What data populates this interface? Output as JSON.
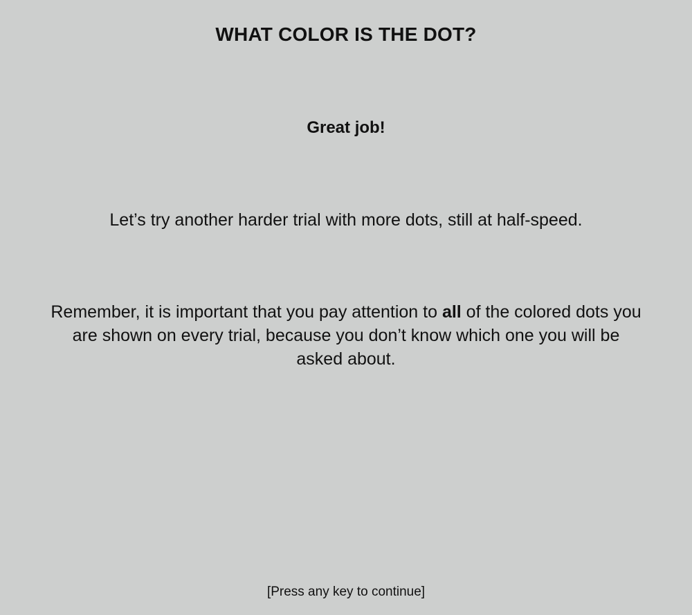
{
  "title": "WHAT COLOR IS THE DOT?",
  "feedback": "Great job!",
  "instruction": "Let’s try another harder trial with more dots, still at half-speed.",
  "reminder": {
    "before": "Remember, it is important that you pay attention to ",
    "emphasis": "all",
    "after": " of the colored dots you are shown on every trial, because you don’t know which one you will be asked about."
  },
  "continue_prompt": "[Press any key to continue]"
}
